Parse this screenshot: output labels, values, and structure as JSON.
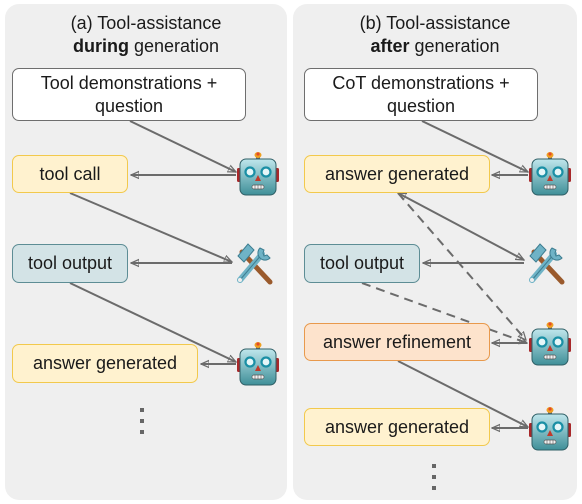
{
  "panels": [
    {
      "id": "a",
      "title_prefix": "(a) Tool-assistance",
      "title_bold": "during",
      "title_suffix": " generation",
      "boxes": {
        "prompt": "Tool demonstrations + question",
        "tool_call": "tool call",
        "tool_output": "tool output",
        "answer": "answer generated"
      },
      "icons": [
        "robot-icon",
        "tools-icon",
        "robot-icon"
      ],
      "continuation": "⋮"
    },
    {
      "id": "b",
      "title_prefix": "(b) Tool-assistance",
      "title_bold": "after",
      "title_suffix": " generation",
      "boxes": {
        "prompt": "CoT demonstrations + question",
        "answer_initial": "answer generated",
        "tool_output": "tool output",
        "refinement": "answer refinement",
        "answer_final": "answer generated"
      },
      "icons": [
        "robot-icon",
        "tools-icon",
        "robot-icon",
        "robot-icon"
      ],
      "continuation": "⋮"
    }
  ],
  "colors": {
    "panel_bg": "#efefef",
    "prompt_box": "#ffffff",
    "generated_box": "#fff2cf",
    "tool_output_box": "#d3e3e6",
    "refinement_box": "#fde3cc",
    "arrow": "#6b6b6b"
  }
}
